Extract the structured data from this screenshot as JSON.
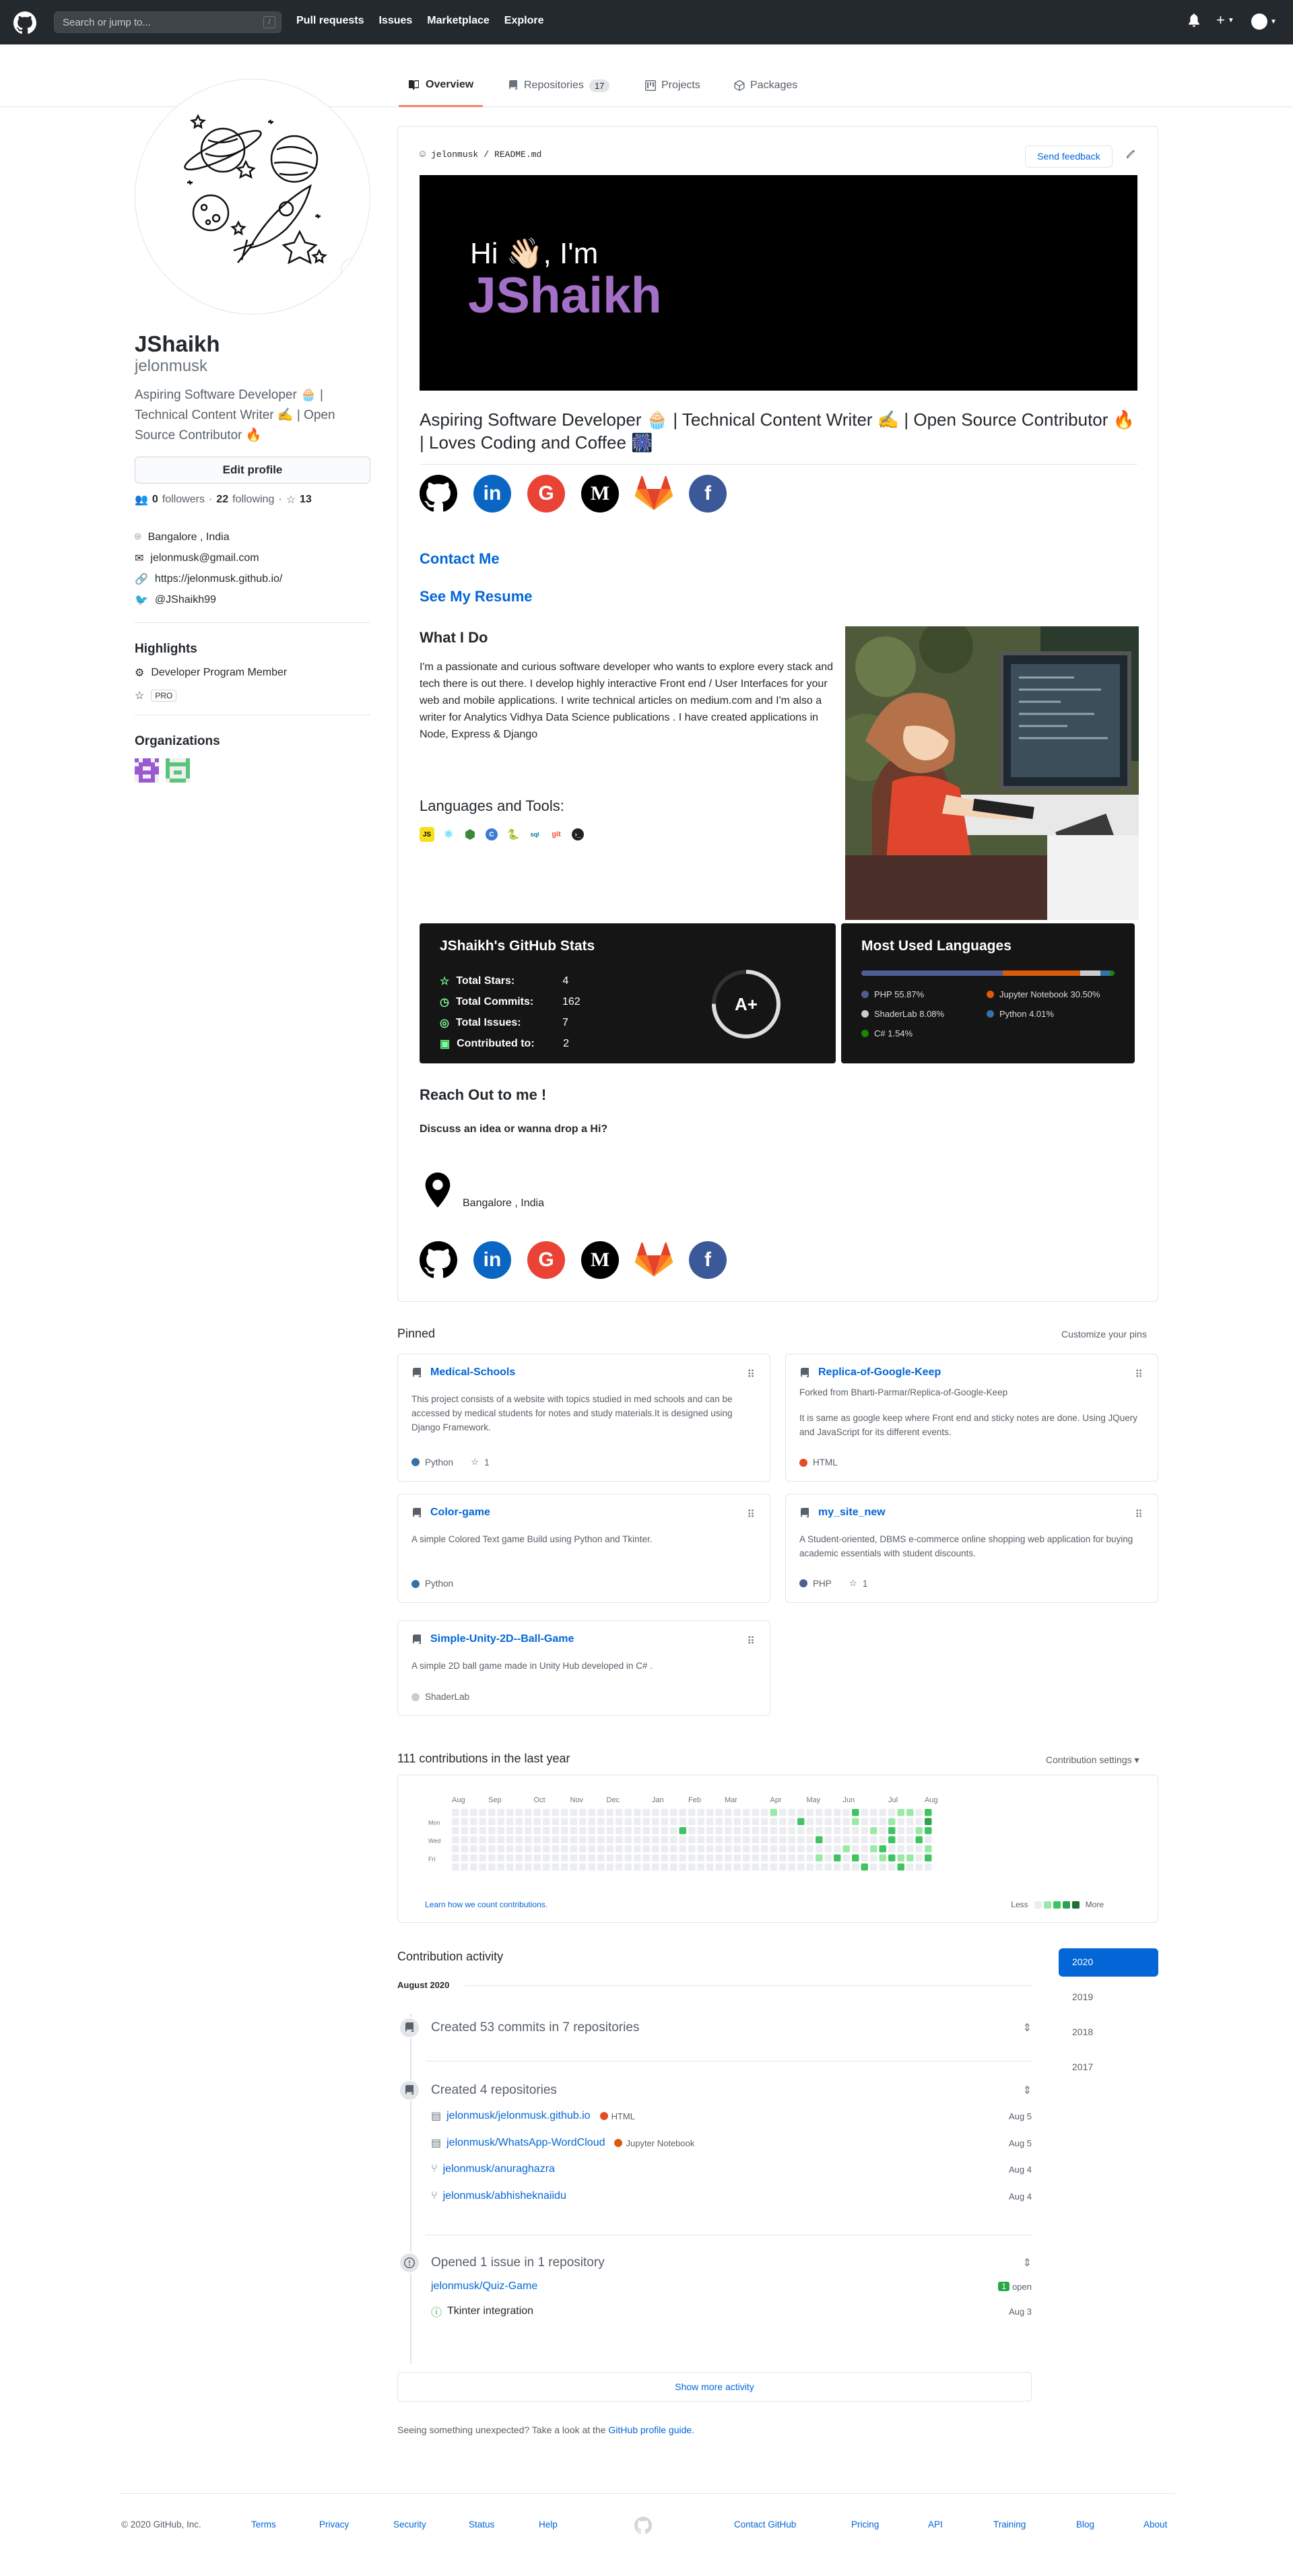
{
  "header": {
    "search_placeholder": "Search or jump to...",
    "search_shortcut": "/",
    "nav": [
      "Pull requests",
      "Issues",
      "Marketplace",
      "Explore"
    ],
    "icons": [
      "github-logo-icon",
      "bell-icon",
      "plus-icon",
      "avatar-icon"
    ]
  },
  "tabs": [
    {
      "label": "Overview",
      "active": true
    },
    {
      "label": "Repositories",
      "count": "17"
    },
    {
      "label": "Projects"
    },
    {
      "label": "Packages"
    }
  ],
  "profile": {
    "name": "JShaikh",
    "login": "jelonmusk",
    "bio": "Aspiring Software Developer 🧁 | Technical Content Writer ✍ | Open Source Contributor 🔥",
    "edit_label": "Edit profile",
    "followers": "0",
    "followers_label": "followers",
    "following": "22",
    "following_label": "following",
    "stars": "13",
    "location": "Bangalore , India",
    "email": "jelonmusk@gmail.com",
    "website": "https://jelonmusk.github.io/",
    "twitter": "@JShaikh99",
    "highlights_title": "Highlights",
    "highlight_1": "Developer Program Member",
    "highlight_2": "PRO",
    "orgs_title": "Organizations"
  },
  "readme": {
    "path_user": "jelonmusk",
    "path_sep": "/",
    "path_file": "README.md",
    "feedback_label": "Send feedback",
    "banner_line1": "Hi 👋🏻, I'm",
    "banner_line2": "JShaikh",
    "tagline": "Aspiring Software Developer 🧁 | Technical Content Writer ✍ | Open Source Contributor 🔥 | Loves Coding and Coffee 🎆",
    "social": [
      {
        "name": "github",
        "glyph": "",
        "color": "#000000"
      },
      {
        "name": "linkedin",
        "glyph": "in",
        "color": "#0a66c2"
      },
      {
        "name": "google",
        "glyph": "G",
        "color": "#ea4335"
      },
      {
        "name": "medium",
        "glyph": "M",
        "color": "#000000"
      },
      {
        "name": "gitlab",
        "glyph": "",
        "color": "#fc6d26"
      },
      {
        "name": "facebook",
        "glyph": "f",
        "color": "#3b5998"
      }
    ],
    "contact_label": "Contact Me",
    "resume_label": "See My Resume",
    "what_title": "What I Do",
    "what_text": "I'm a passionate and curious software developer who wants to explore every stack and tech there is out there. I develop highly interactive Front end / User Interfaces for your web and mobile applications. I write technical articles on medium.com and I'm also a writer for Analytics Vidhya Data Science publications . I have created applications in Node, Express & Django",
    "langs_title": "Languages and Tools:",
    "stats": {
      "title": "JShaikh's GitHub Stats",
      "rows": [
        {
          "label": "Total Stars:",
          "value": "4"
        },
        {
          "label": "Total Commits:",
          "value": "162"
        },
        {
          "label": "Total Issues:",
          "value": "7"
        },
        {
          "label": "Contributed to:",
          "value": "2"
        }
      ],
      "grade": "A+",
      "grade_fraction": 0.75
    },
    "languages": {
      "title": "Most Used Languages",
      "items": [
        {
          "label": "PHP 55.87%",
          "share": 55.87,
          "color": "#4F5D95"
        },
        {
          "label": "Jupyter Notebook 30.50%",
          "share": 30.5,
          "color": "#DA5B0B"
        },
        {
          "label": "ShaderLab 8.08%",
          "share": 8.08,
          "color": "#cccccc"
        },
        {
          "label": "Python 4.01%",
          "share": 4.01,
          "color": "#3572A5"
        },
        {
          "label": "C# 1.54%",
          "share": 1.54,
          "color": "#178600"
        }
      ]
    },
    "reach_title": "Reach Out to me !",
    "discuss": "Discuss an idea or wanna drop a Hi?",
    "location": "Bangalore , India"
  },
  "pinned": {
    "title": "Pinned",
    "customize": "Customize your pins",
    "cards": [
      {
        "name": "Medical-Schools",
        "desc": "This project consists of a website with topics studied in med schools and can be accessed by medical students for notes and study materials.It is designed using Django Framework.",
        "lang": "Python",
        "color": "#3572A5",
        "stars": "1"
      },
      {
        "name": "Replica-of-Google-Keep",
        "fork": "Forked from Bharti-Parmar/Replica-of-Google-Keep",
        "desc": "It is same as google keep where Front end and sticky notes are done. Using JQuery and JavaScript for its different events.",
        "lang": "HTML",
        "color": "#e34c26"
      },
      {
        "name": "Color-game",
        "desc": "A simple Colored Text game Build using Python and Tkinter.",
        "lang": "Python",
        "color": "#3572A5"
      },
      {
        "name": "my_site_new",
        "desc": "A Student-oriented, DBMS e-commerce online shopping web application for buying academic essentials with student discounts.",
        "lang": "PHP",
        "color": "#4F5D95",
        "stars": "1"
      },
      {
        "name": "Simple-Unity-2D--Ball-Game",
        "desc": "A simple 2D ball game made in Unity Hub developed in C# .",
        "lang": "ShaderLab",
        "color": "#cccccc"
      }
    ]
  },
  "contributions": {
    "title": "111 contributions in the last year",
    "settings": "Contribution settings ▾",
    "months": [
      "Aug",
      "Sep",
      "Oct",
      "Nov",
      "Dec",
      "Jan",
      "Feb",
      "Mar",
      "Apr",
      "May",
      "Jun",
      "Jul",
      "Aug"
    ],
    "days": [
      "Mon",
      "Wed",
      "Fri"
    ],
    "learn": "Learn how we count contributions.",
    "less": "Less",
    "more": "More"
  },
  "activity": {
    "title": "Contribution activity",
    "month": "August 2020",
    "commits": "Created 53 commits in 7 repositories",
    "repos_title": "Created 4 repositories",
    "repos": [
      {
        "name": "jelonmusk/jelonmusk.github.io",
        "lang": "HTML",
        "color": "#e34c26",
        "date": "Aug 5"
      },
      {
        "name": "jelonmusk/WhatsApp-WordCloud",
        "lang": "Jupyter Notebook",
        "color": "#DA5B0B",
        "date": "Aug 5"
      },
      {
        "name": "jelonmusk/anuraghazra",
        "date": "Aug 4"
      },
      {
        "name": "jelonmusk/abhisheknaiidu",
        "date": "Aug 4"
      }
    ],
    "issues_title": "Opened 1 issue in 1 repository",
    "issue_repo": "jelonmusk/Quiz-Game",
    "issue_count": "1",
    "issue_open": "open",
    "issue_name": "Tkinter integration",
    "issue_date": "Aug 3",
    "show_more": "Show more activity",
    "unexpected": "Seeing something unexpected? Take a look at the",
    "guide": "GitHub profile guide.",
    "years": [
      "2020",
      "2019",
      "2018",
      "2017"
    ]
  },
  "footer": {
    "copyright": "© 2020 GitHub, Inc.",
    "left": [
      "Terms",
      "Privacy",
      "Security",
      "Status",
      "Help"
    ],
    "right": [
      "Contact GitHub",
      "Pricing",
      "API",
      "Training",
      "Blog",
      "About"
    ]
  }
}
